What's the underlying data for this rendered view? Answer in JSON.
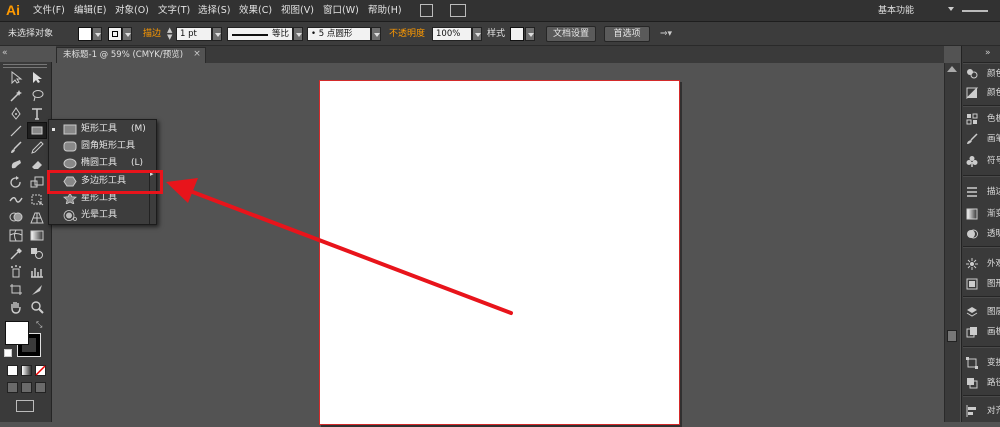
{
  "app": {
    "logo": "Ai"
  },
  "menubar": {
    "items": [
      "文件(F)",
      "编辑(E)",
      "对象(O)",
      "文字(T)",
      "选择(S)",
      "效果(C)",
      "视图(V)",
      "窗口(W)",
      "帮助(H)"
    ],
    "workspace": "基本功能"
  },
  "controlbar": {
    "selection_label": "未选择对象",
    "stroke_label": "描边",
    "stroke_weight": "1 pt",
    "stroke_profile": "等比",
    "brush": "5 点圆形",
    "opacity_label": "不透明度",
    "opacity_value": "100%",
    "style_label": "样式",
    "doc_setup_button": "文档设置",
    "preferences_button": "首选项"
  },
  "document_tab": {
    "title": "未标题-1 @ 59% (CMYK/预览)",
    "close": "×"
  },
  "flyout": {
    "items": [
      {
        "label": "矩形工具",
        "shortcut": "(M)",
        "icon": "rectangle-icon",
        "checked": true
      },
      {
        "label": "圆角矩形工具",
        "shortcut": "",
        "icon": "rounded-rectangle-icon",
        "checked": false
      },
      {
        "label": "椭圆工具",
        "shortcut": "(L)",
        "icon": "ellipse-icon",
        "checked": false
      },
      {
        "label": "多边形工具",
        "shortcut": "",
        "icon": "polygon-icon",
        "checked": false
      },
      {
        "label": "星形工具",
        "shortcut": "",
        "icon": "star-icon",
        "checked": false
      },
      {
        "label": "光晕工具",
        "shortcut": "",
        "icon": "flare-icon",
        "checked": false
      }
    ],
    "highlighted_index": 3
  },
  "right_panel": {
    "items": [
      {
        "label": "颜色",
        "icon": "color-icon"
      },
      {
        "label": "颜色参考",
        "icon": "color-guide-icon"
      },
      {
        "label": "色板",
        "icon": "swatches-icon"
      },
      {
        "label": "画笔",
        "icon": "brushes-icon"
      },
      {
        "label": "符号",
        "icon": "symbols-icon"
      },
      {
        "label": "描边",
        "icon": "stroke-icon"
      },
      {
        "label": "渐变",
        "icon": "gradient-icon"
      },
      {
        "label": "透明度",
        "icon": "transparency-icon"
      },
      {
        "label": "外观",
        "icon": "appearance-icon"
      },
      {
        "label": "图形样式",
        "icon": "graphic-styles-icon"
      },
      {
        "label": "图层",
        "icon": "layers-icon"
      },
      {
        "label": "画板",
        "icon": "artboards-icon"
      },
      {
        "label": "变换",
        "icon": "transform-icon"
      },
      {
        "label": "路径查找器",
        "icon": "pathfinder-icon"
      },
      {
        "label": "对齐",
        "icon": "align-icon"
      }
    ]
  },
  "colors": {
    "accent_orange": "#ff9a00",
    "highlight_red": "#e8141b",
    "artboard_border": "#d42a2a"
  }
}
